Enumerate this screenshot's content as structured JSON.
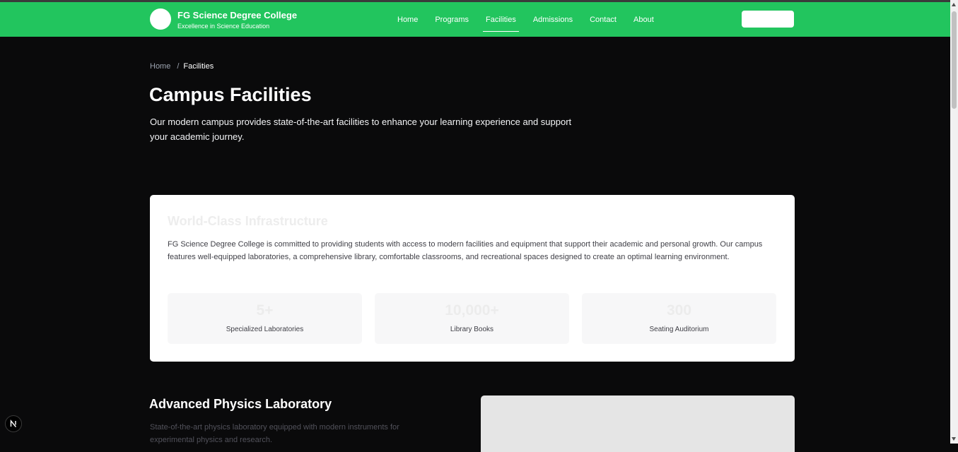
{
  "header": {
    "brand_title": "FG Science Degree College",
    "brand_subtitle": "Excellence in Science Education",
    "nav": [
      {
        "label": "Home",
        "active": false
      },
      {
        "label": "Programs",
        "active": false
      },
      {
        "label": "Facilities",
        "active": true
      },
      {
        "label": "Admissions",
        "active": false
      },
      {
        "label": "Contact",
        "active": false
      },
      {
        "label": "About",
        "active": false
      }
    ],
    "button_label": ""
  },
  "breadcrumb": {
    "home": "Home",
    "separator": "/",
    "current": "Facilities"
  },
  "page": {
    "title": "Campus Facilities",
    "intro": "Our modern campus provides state-of-the-art facilities to enhance your learning experience and support your academic journey."
  },
  "infrastructure": {
    "title": "World-Class Infrastructure",
    "text": "FG Science Degree College is committed to providing students with access to modern facilities and equipment that support their academic and personal growth. Our campus features well-equipped laboratories, a comprehensive library, comfortable classrooms, and recreational spaces designed to create an optimal learning environment.",
    "stats": [
      {
        "value": "5+",
        "label": "Specialized Laboratories"
      },
      {
        "value": "10,000+",
        "label": "Library Books"
      },
      {
        "value": "300",
        "label": "Seating Auditorium"
      }
    ]
  },
  "physics_lab": {
    "title": "Advanced Physics Laboratory",
    "description": "State-of-the-art physics laboratory equipped with modern instruments for experimental physics and research."
  },
  "dev_badge": {
    "label": "N",
    "icon": "nextjs-logo-icon"
  },
  "colors": {
    "accent": "#22c55e",
    "background": "#0a0a0b",
    "card": "#ffffff"
  }
}
